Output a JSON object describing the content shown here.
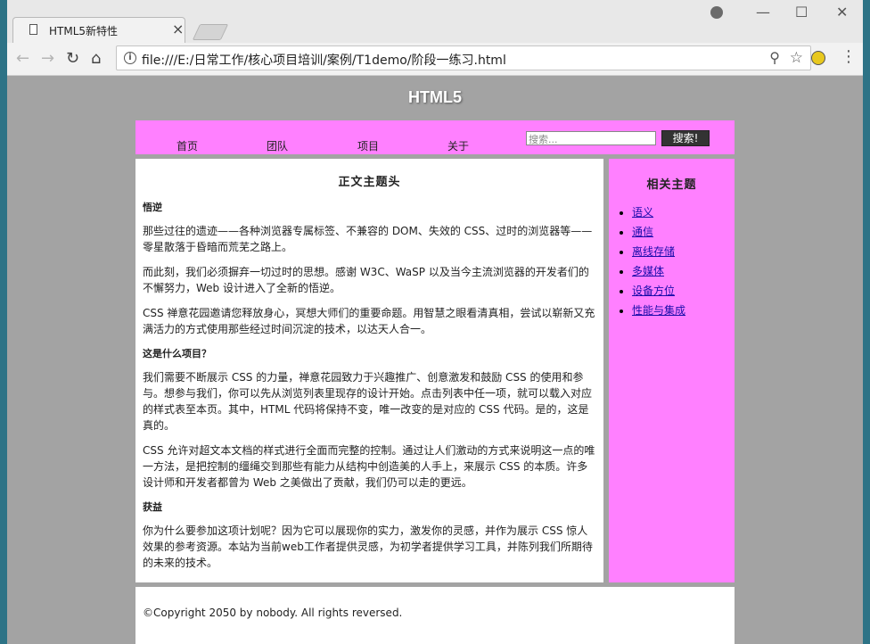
{
  "browser": {
    "tab_title": "HTML5新特性",
    "tab_close": "×",
    "url": "file:///E:/日常工作/核心项目培训/案例/T1demo/阶段一练习.html",
    "window_controls": {
      "minimize": "—",
      "maximize": "☐",
      "close": "✕"
    }
  },
  "page": {
    "site_title": "HTML5",
    "nav": [
      "首页",
      "团队",
      "项目",
      "关于"
    ],
    "search": {
      "placeholder": "搜索...",
      "button": "搜索!"
    },
    "main": {
      "heading": "正文主题头",
      "sections": [
        {
          "title": "悟逆",
          "paragraphs": [
            "那些过往的遗迹——各种浏览器专属标签、不兼容的 DOM、失效的 CSS、过时的浏览器等——零星散落于昏暗而荒芜之路上。",
            "而此刻，我们必须摒弃一切过时的思想。感谢 W3C、WaSP 以及当今主流浏览器的开发者们的不懈努力，Web 设计进入了全新的悟逆。",
            "CSS 禅意花园邀请您释放身心，冥想大师们的重要命题。用智慧之眼看清真相，尝试以崭新又充满活力的方式使用那些经过时间沉淀的技术，以达天人合一。"
          ]
        },
        {
          "title": "这是什么项目？",
          "paragraphs": [
            "我们需要不断展示 CSS 的力量，禅意花园致力于兴趣推广、创意激发和鼓励 CSS 的使用和参与。想参与我们，你可以先从浏览列表里现存的设计开始。点击列表中任一项，就可以载入对应的样式表至本页。其中，HTML 代码将保持不变，唯一改变的是对应的 CSS 代码。是的，这是真的。",
            "CSS 允许对超文本文档的样式进行全面而完整的控制。通过让人们激动的方式来说明这一点的唯一方法，是把控制的缰绳交到那些有能力从结构中创造美的人手上，来展示 CSS 的本质。许多设计师和开发者都曾为 Web 之美做出了贡献，我们仍可以走的更远。"
          ]
        },
        {
          "title": "获益",
          "paragraphs": [
            "你为什么要参加这项计划呢？因为它可以展现你的实力，激发你的灵感，并作为展示 CSS 惊人效果的参考资源。本站为当前web工作者提供灵感，为初学者提供学习工具，并陈列我们所期待的未来的技术。"
          ]
        }
      ]
    },
    "aside": {
      "heading": "相关主题",
      "links": [
        "语义",
        "通信",
        "离线存储",
        "多媒体",
        "设备方位",
        "性能与集成"
      ]
    },
    "footer": "©Copyright 2050 by nobody. All rights reversed."
  },
  "colors": {
    "nav_bg": "#ff80ff",
    "page_bg": "#a3a3a3",
    "search_btn_bg": "#333333",
    "link": "#1a0dab"
  }
}
